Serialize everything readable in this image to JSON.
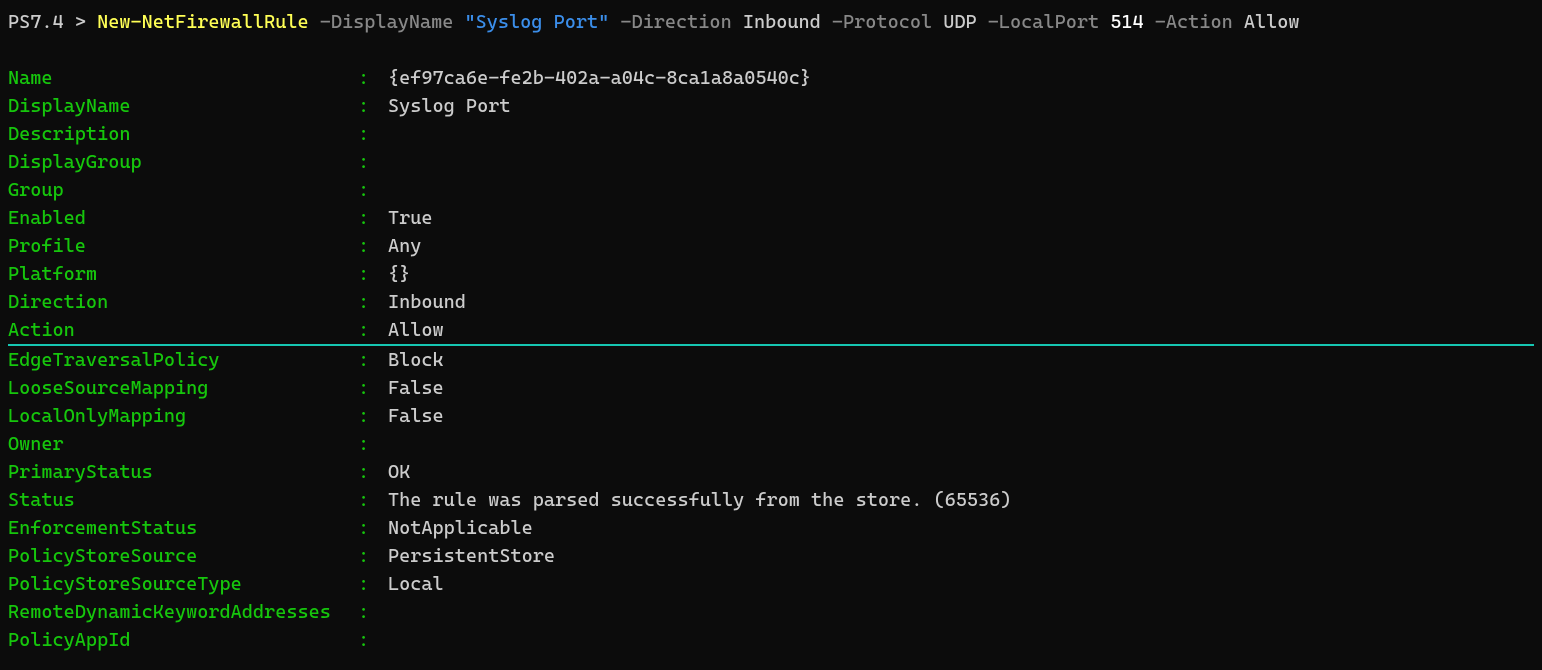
{
  "prompt": {
    "shell": "PS7.4",
    "separator": ">",
    "cmdlet": "New-NetFirewallRule",
    "params": [
      {
        "flag": "-DisplayName",
        "value": "\"Syslog Port\"",
        "kind": "str"
      },
      {
        "flag": "-Direction",
        "value": "Inbound",
        "kind": "enum"
      },
      {
        "flag": "-Protocol",
        "value": "UDP",
        "kind": "enum"
      },
      {
        "flag": "-LocalPort",
        "value": "514",
        "kind": "num"
      },
      {
        "flag": "-Action",
        "value": "Allow",
        "kind": "enum"
      }
    ]
  },
  "output": {
    "rows": [
      {
        "key": "Name",
        "value": "{ef97ca6e-fe2b-402a-a04c-8ca1a8a0540c}"
      },
      {
        "key": "DisplayName",
        "value": "Syslog Port"
      },
      {
        "key": "Description",
        "value": ""
      },
      {
        "key": "DisplayGroup",
        "value": ""
      },
      {
        "key": "Group",
        "value": ""
      },
      {
        "key": "Enabled",
        "value": "True"
      },
      {
        "key": "Profile",
        "value": "Any"
      },
      {
        "key": "Platform",
        "value": "{}"
      },
      {
        "key": "Direction",
        "value": "Inbound"
      },
      {
        "key": "Action",
        "value": "Allow",
        "underlined": true
      },
      {
        "key": "EdgeTraversalPolicy",
        "value": "Block"
      },
      {
        "key": "LooseSourceMapping",
        "value": "False"
      },
      {
        "key": "LocalOnlyMapping",
        "value": "False"
      },
      {
        "key": "Owner",
        "value": ""
      },
      {
        "key": "PrimaryStatus",
        "value": "OK"
      },
      {
        "key": "Status",
        "value": "The rule was parsed successfully from the store. (65536)"
      },
      {
        "key": "EnforcementStatus",
        "value": "NotApplicable"
      },
      {
        "key": "PolicyStoreSource",
        "value": "PersistentStore"
      },
      {
        "key": "PolicyStoreSourceType",
        "value": "Local"
      },
      {
        "key": "RemoteDynamicKeywordAddresses",
        "value": "",
        "wide": true
      },
      {
        "key": "PolicyAppId",
        "value": ""
      }
    ]
  }
}
